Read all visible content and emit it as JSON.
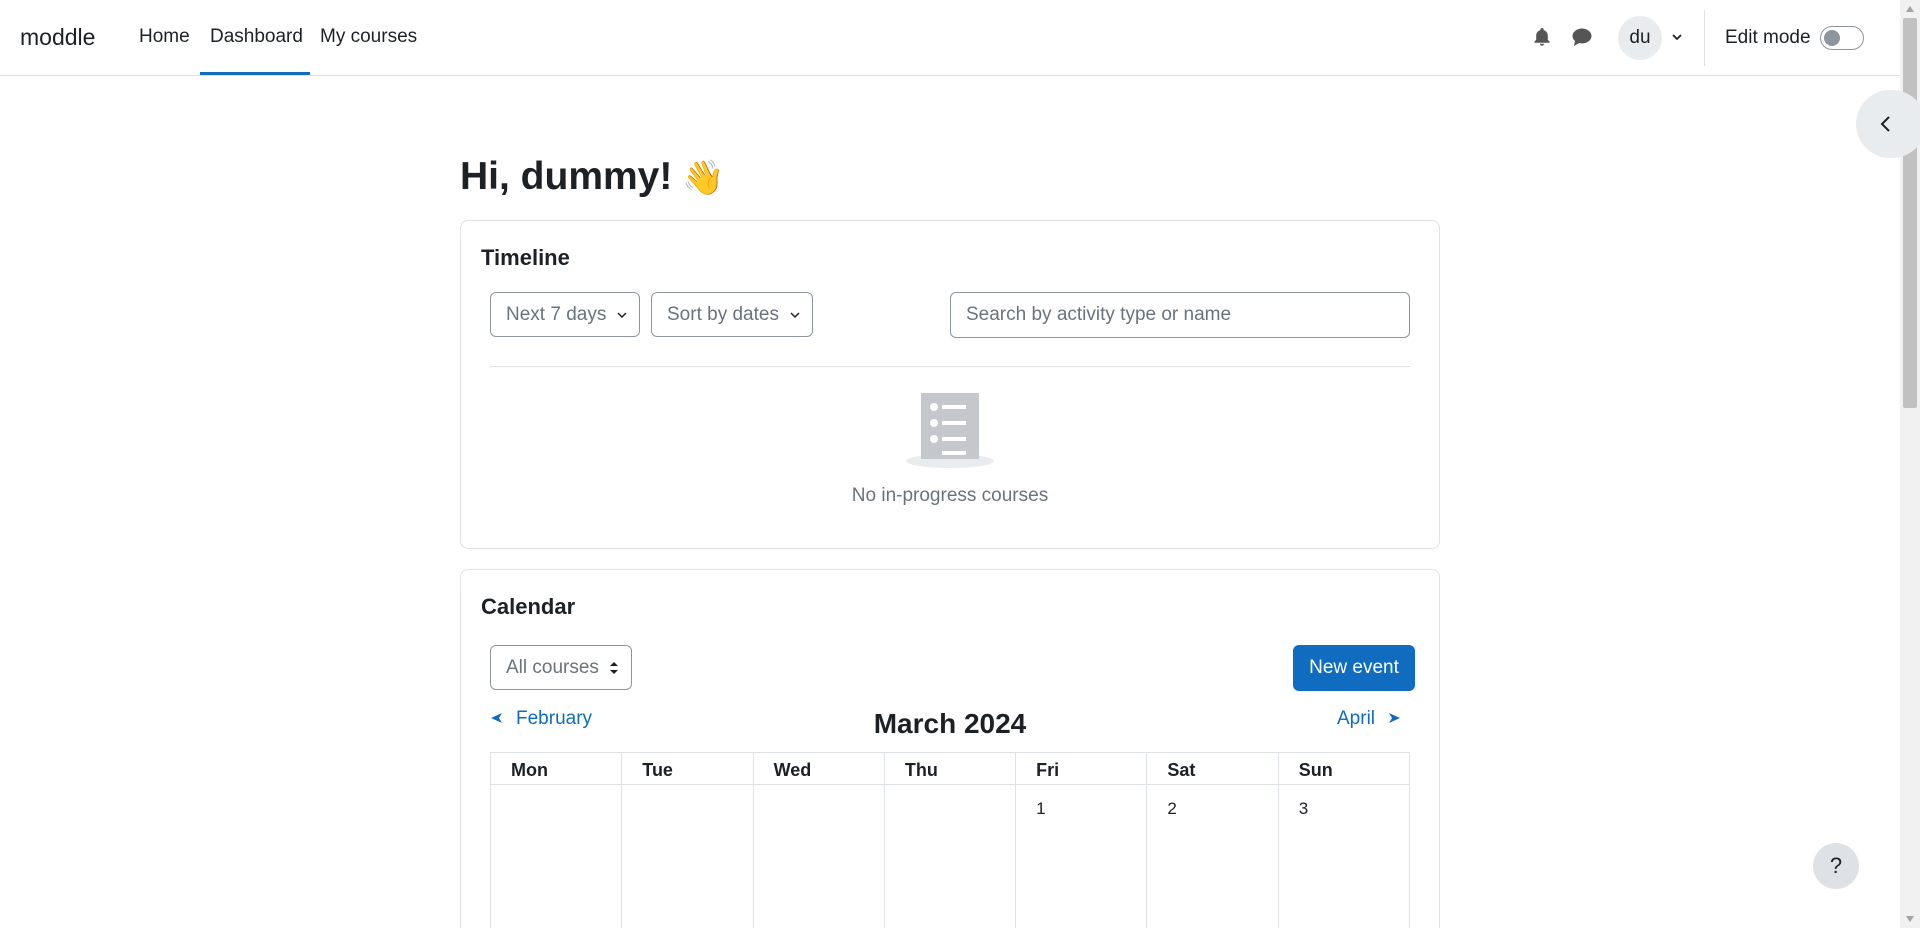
{
  "navbar": {
    "brand": "moddle",
    "links": [
      {
        "label": "Home",
        "active": false
      },
      {
        "label": "Dashboard",
        "active": true
      },
      {
        "label": "My courses",
        "active": false
      }
    ],
    "notification_icon": "bell-icon",
    "messages_icon": "speech-bubble-icon",
    "avatar_initials": "du",
    "edit_mode_label": "Edit mode",
    "edit_mode_on": false,
    "accent_color": "#0f6cbf"
  },
  "main": {
    "greeting": "Hi, dummy!",
    "greeting_emoji": "👋"
  },
  "timeline": {
    "title": "Timeline",
    "range_filter": "Next 7 days",
    "sort_filter": "Sort by dates",
    "search_placeholder": "Search by activity type or name",
    "empty_message": "No in-progress courses"
  },
  "calendar": {
    "title": "Calendar",
    "course_filter": "All courses",
    "new_event_label": "New event",
    "prev_month": "February",
    "next_month": "April",
    "current_month": "March 2024",
    "weekdays": [
      "Mon",
      "Tue",
      "Wed",
      "Thu",
      "Fri",
      "Sat",
      "Sun"
    ],
    "first_week": [
      "",
      "",
      "",
      "",
      "1",
      "2",
      "3"
    ]
  },
  "help_label": "?"
}
